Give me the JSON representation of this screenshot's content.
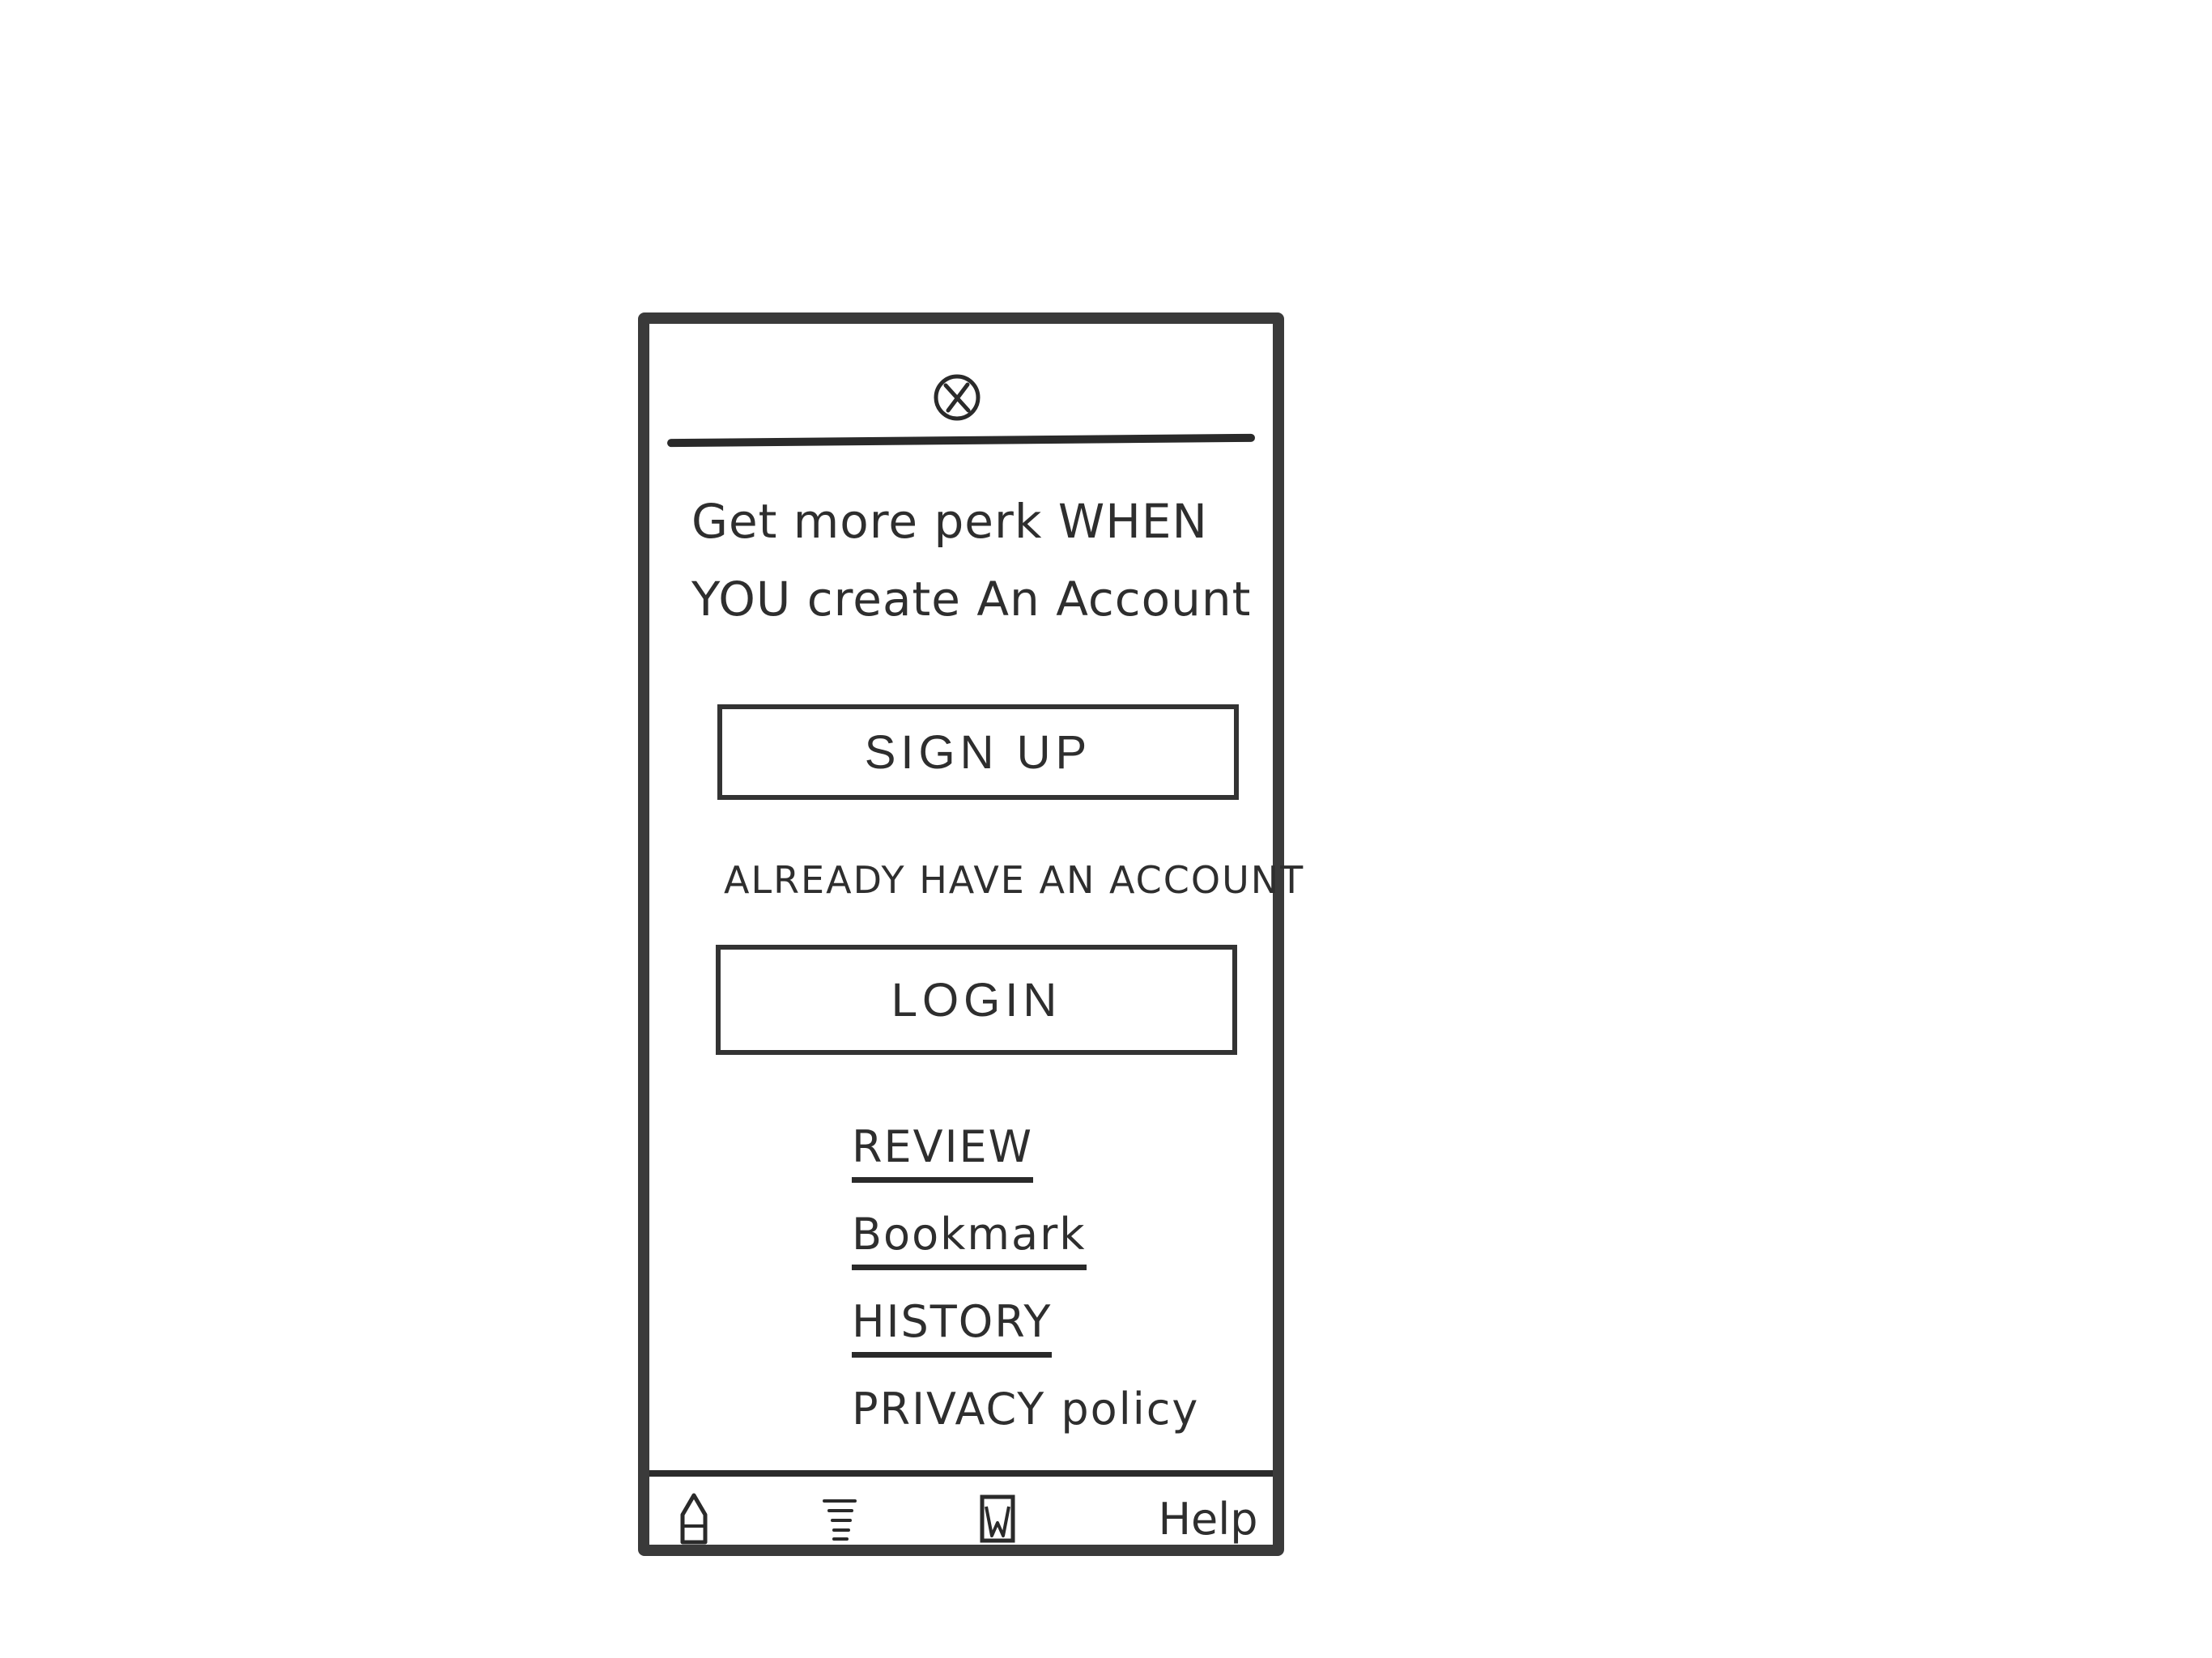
{
  "header": {
    "close_icon": "close-circle-icon"
  },
  "promo": {
    "headline": "Get more perk WHEN YOU create An Account"
  },
  "signup": {
    "label": "SIGN UP"
  },
  "login_section": {
    "prompt": "ALREADY HAVE AN ACCOUNT",
    "login_label": "LOGIN"
  },
  "links": [
    {
      "label": "REVIEW",
      "underlined": true
    },
    {
      "label": "Bookmark",
      "underlined": true
    },
    {
      "label": "HISTORY",
      "underlined": true
    },
    {
      "label": "PRIVACY policy",
      "underlined": false
    }
  ],
  "bottom_nav": {
    "home_icon": "home-icon",
    "menu_icon": "menu-icon",
    "bookmark_icon": "bookmark-icon",
    "help_label": "Help"
  }
}
